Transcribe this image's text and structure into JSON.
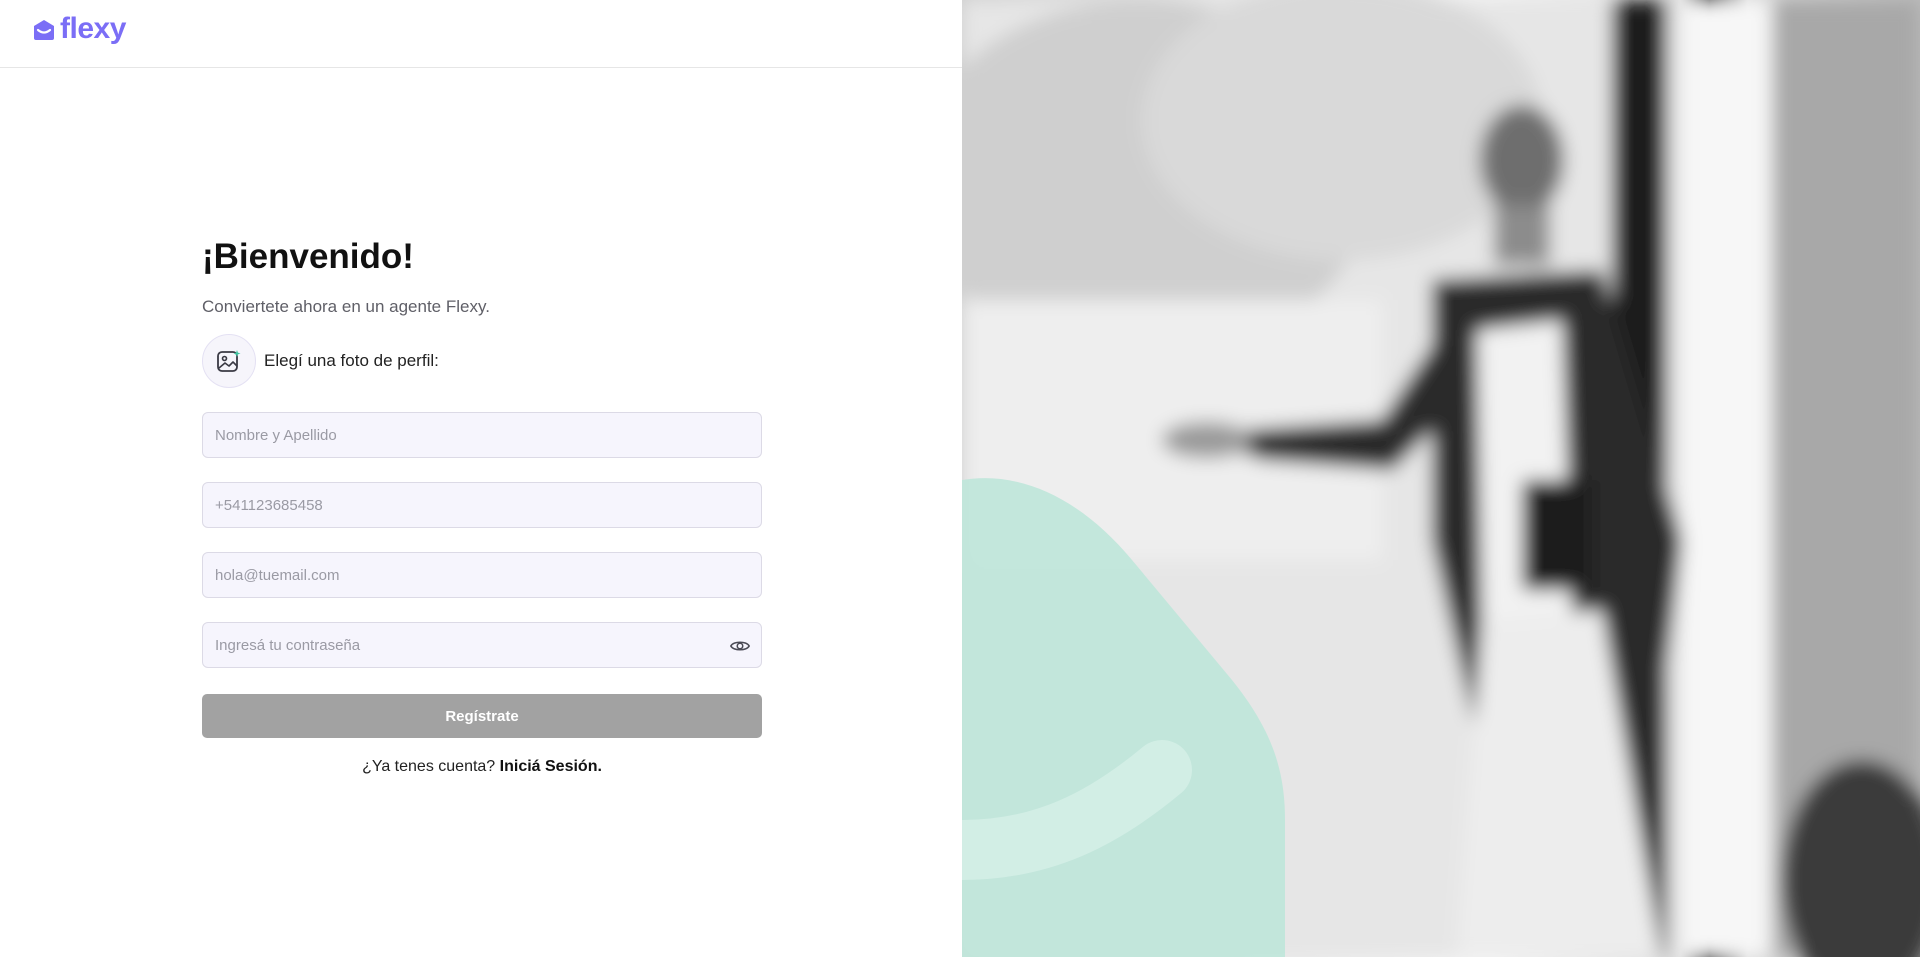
{
  "app": {
    "logo_text": "flexy",
    "brand_color": "#7b6ef6"
  },
  "form": {
    "title": "¡Bienvenido!",
    "subtitle": "Conviertete ahora en un agente Flexy.",
    "photo_label": "Elegí una foto de perfil:",
    "name_placeholder": "Nombre y Apellido",
    "phone_placeholder": "+541123685458",
    "email_placeholder": "hola@tuemail.com",
    "password_placeholder": "Ingresá tu contraseña",
    "submit_label": "Regístrate",
    "login_prompt": "¿Ya tenes cuenta?",
    "login_link": "Iniciá Sesión."
  },
  "colors": {
    "input_bg": "#f6f5fd",
    "button_disabled": "#a2a2a2",
    "accent_green": "#b9e3d6"
  },
  "icons": {
    "logo": "flexy-logo-icon",
    "profile_photo": "image-add-icon",
    "password_toggle": "eye-icon"
  }
}
